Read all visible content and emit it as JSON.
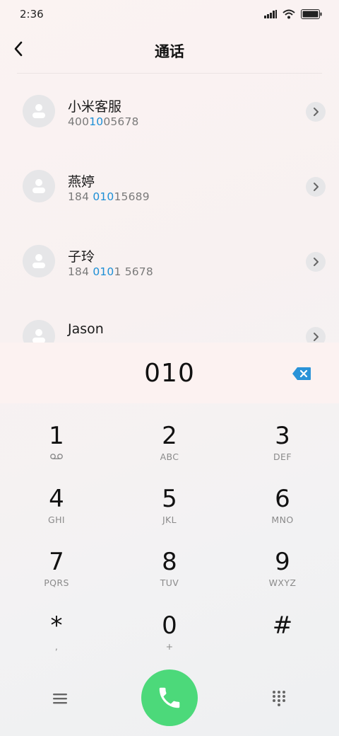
{
  "status_bar": {
    "time": "2:36"
  },
  "header": {
    "title": "通话"
  },
  "contacts": [
    {
      "name": "小米客服",
      "number_pre": "400",
      "number_match": "10",
      "number_post": "05678"
    },
    {
      "name": "燕婷",
      "number_pre": "184 ",
      "number_match": "010",
      "number_post": "15689"
    },
    {
      "name": "子玲",
      "number_pre": "184 ",
      "number_match": "010",
      "number_post": "1 5678"
    },
    {
      "name": "Jason",
      "number_pre": "",
      "number_match": "",
      "number_post": ""
    }
  ],
  "dialer": {
    "input": "010"
  },
  "keypad": [
    {
      "digit": "1",
      "letters": ""
    },
    {
      "digit": "2",
      "letters": "ABC"
    },
    {
      "digit": "3",
      "letters": "DEF"
    },
    {
      "digit": "4",
      "letters": "GHI"
    },
    {
      "digit": "5",
      "letters": "JKL"
    },
    {
      "digit": "6",
      "letters": "MNO"
    },
    {
      "digit": "7",
      "letters": "PQRS"
    },
    {
      "digit": "8",
      "letters": "TUV"
    },
    {
      "digit": "9",
      "letters": "WXYZ"
    },
    {
      "digit": "*",
      "letters": ","
    },
    {
      "digit": "0",
      "letters": "+"
    },
    {
      "digit": "#",
      "letters": ""
    }
  ],
  "icons": {
    "back": "chevron-left-icon",
    "chevron": "chevron-right-icon",
    "backspace": "backspace-icon",
    "voicemail": "voicemail-icon",
    "call": "phone-icon",
    "menu": "menu-icon",
    "keypad": "keypad-icon"
  },
  "colors": {
    "accent": "#1d8fd6",
    "call": "#4cd97a",
    "backspace": "#2a93d8"
  }
}
